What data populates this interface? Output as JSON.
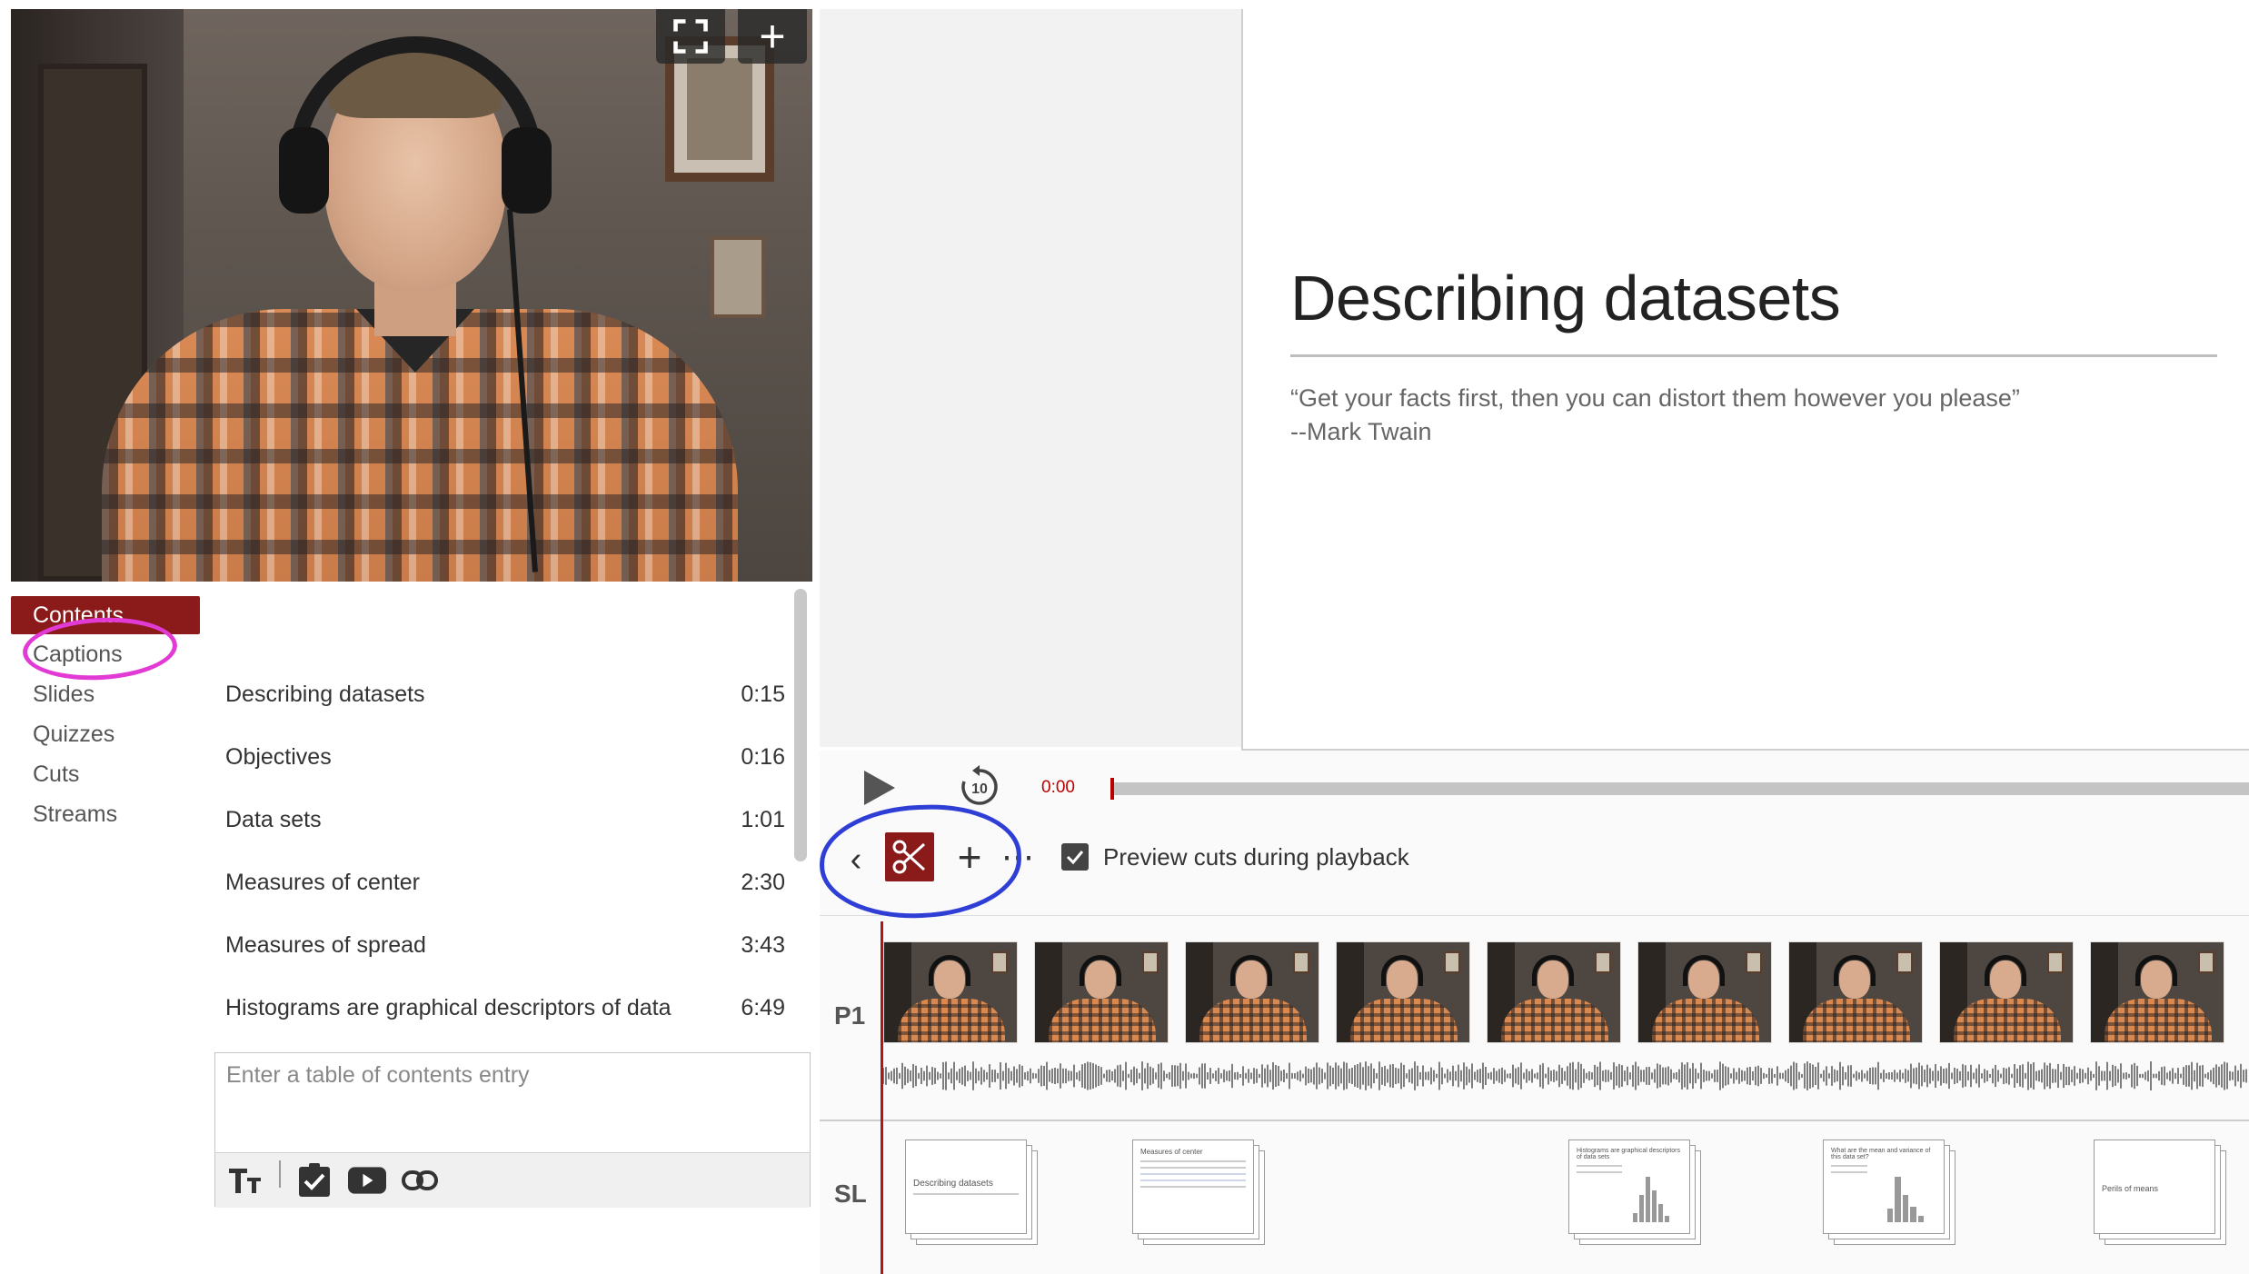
{
  "video": {
    "fullscreen_icon": "fullscreen-icon",
    "add_icon": "plus-icon"
  },
  "nav": {
    "items": [
      {
        "label": "Contents",
        "active": true
      },
      {
        "label": "Captions",
        "active": false
      },
      {
        "label": "Slides",
        "active": false
      },
      {
        "label": "Quizzes",
        "active": false
      },
      {
        "label": "Cuts",
        "active": false
      },
      {
        "label": "Streams",
        "active": false
      }
    ]
  },
  "toc": {
    "entries": [
      {
        "title": "Describing datasets",
        "time": "0:15"
      },
      {
        "title": "Objectives",
        "time": "0:16"
      },
      {
        "title": "Data sets",
        "time": "1:01"
      },
      {
        "title": "Measures of center",
        "time": "2:30"
      },
      {
        "title": "Measures of spread",
        "time": "3:43"
      },
      {
        "title": "Histograms are graphical descriptors of data",
        "time": "6:49"
      }
    ],
    "entry_placeholder": "Enter a table of contents entry",
    "tools": [
      "text-format-icon",
      "checkbox-icon",
      "youtube-icon",
      "link-icon"
    ]
  },
  "slide": {
    "title": "Describing datasets",
    "quote": "“Get your facts first, then you can distort them however you please”",
    "attribution": "--Mark Twain"
  },
  "player": {
    "time": "0:00",
    "replay_seconds": "10"
  },
  "cut_toolbar": {
    "preview_label": "Preview cuts during playback",
    "preview_checked": true
  },
  "tracks": {
    "p1_label": "P1",
    "sl_label": "SL",
    "slide_thumbs": [
      {
        "title": "Describing datasets"
      },
      {
        "title": "Measures of center"
      },
      {
        "title": "Histograms are graphical descriptors of data sets"
      },
      {
        "title": "What are the mean and variance of this data set?"
      },
      {
        "title": "Perils of means"
      }
    ]
  },
  "annotations": {
    "captions_circle_color": "#e23ad5",
    "tools_circle_color": "#2f3fd6"
  },
  "colors": {
    "accent": "#8b1a1a",
    "playhead": "#b01818"
  }
}
